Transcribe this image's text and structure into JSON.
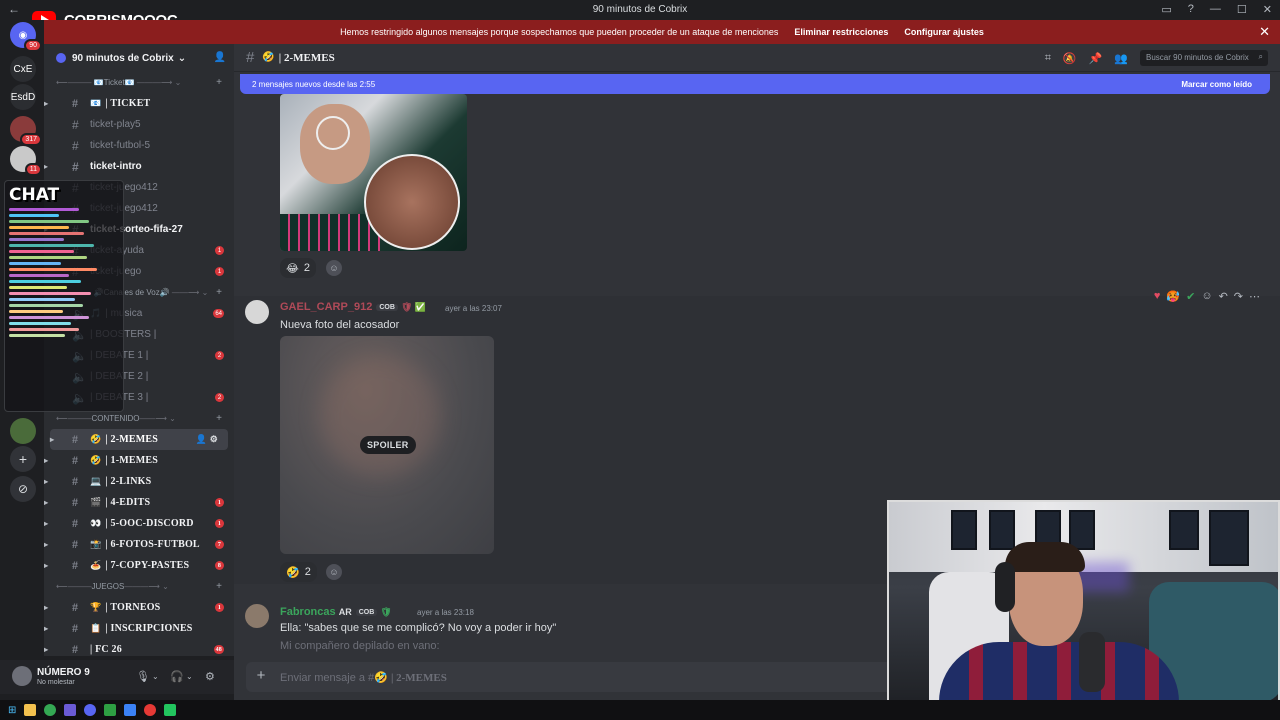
{
  "titlebar": {
    "back_icon": "arrow-left-icon",
    "youtube_channel": "COBRISMOOOC",
    "window_title": "90 minutos de Cobrix"
  },
  "banner": {
    "message": "Hemos restringido algunos mensajes porque sospechamos que pueden proceder de un ataque de menciones",
    "remove_label": "Eliminar restricciones",
    "settings_label": "Configurar ajustes"
  },
  "rail": {
    "items": [
      {
        "label": "",
        "badge": "90"
      },
      {
        "label": "CxE",
        "badge": ""
      },
      {
        "label": "EsdD",
        "badge": ""
      },
      {
        "label": "",
        "badge": "317"
      },
      {
        "label": "",
        "badge": "11"
      }
    ]
  },
  "overlay": {
    "chat_title": "CHAT"
  },
  "server": {
    "name": "90 minutos de Cobrix"
  },
  "sidebar": {
    "categories": {
      "ticket": "Ticket",
      "voice": "Canales de Voz",
      "content": "CONTENIDO",
      "games": "JUEGOS"
    },
    "ticket_channels": [
      {
        "emoji": "📧",
        "name": "| TICKET",
        "badge": "",
        "unread": true
      },
      {
        "emoji": "",
        "name": "ticket-play5",
        "badge": "",
        "unread": false
      },
      {
        "emoji": "",
        "name": "ticket-futbol-5",
        "badge": "",
        "unread": false
      },
      {
        "emoji": "",
        "name": "ticket-intro",
        "badge": "",
        "unread": true
      },
      {
        "emoji": "",
        "name": "ticket-juego412",
        "badge": "",
        "unread": false
      },
      {
        "emoji": "",
        "name": "ticket-juego412",
        "badge": "",
        "unread": false
      },
      {
        "emoji": "",
        "name": "ticket-sorteo-fifa-27",
        "badge": "",
        "unread": true
      },
      {
        "emoji": "",
        "name": "ticket-ayuda",
        "badge": "1",
        "unread": false
      },
      {
        "emoji": "",
        "name": "ticket-juego",
        "badge": "1",
        "unread": false
      }
    ],
    "voice_channels": [
      {
        "name": "| musica",
        "badge": "64"
      },
      {
        "name": "| BOOSTERS |",
        "badge": ""
      },
      {
        "name": "| DEBATE 1 |",
        "badge": "2"
      },
      {
        "name": "| DEBATE 2 |",
        "badge": ""
      },
      {
        "name": "| DEBATE 3 |",
        "badge": "2"
      }
    ],
    "content_channels": [
      {
        "emoji": "🤣",
        "name": "| 2-MEMES",
        "badge": "",
        "active": true
      },
      {
        "emoji": "🤣",
        "name": "| 1-MEMES",
        "badge": ""
      },
      {
        "emoji": "💻",
        "name": "| 2-LINKS",
        "badge": ""
      },
      {
        "emoji": "🎬",
        "name": "| 4-EDITS",
        "badge": "1"
      },
      {
        "emoji": "👀",
        "name": "| 5-OOC-DISCORD",
        "badge": "1"
      },
      {
        "emoji": "📸",
        "name": "| 6-FOTOS-FUTBOL",
        "badge": "7"
      },
      {
        "emoji": "🍝",
        "name": "| 7-COPY-PASTES",
        "badge": "8"
      }
    ],
    "game_channels": [
      {
        "emoji": "🏆",
        "name": "| TORNEOS",
        "badge": "1"
      },
      {
        "emoji": "📋",
        "name": "| INSCRIPCIONES",
        "badge": ""
      },
      {
        "emoji": "",
        "name": "| FC 26",
        "badge": "48"
      }
    ]
  },
  "user": {
    "name": "NÚMERO 9",
    "status": "No molestar"
  },
  "channel_header": {
    "emoji": "🤣",
    "name": "| 2-MEMES",
    "search_placeholder": "Buscar 90 minutos de Cobrix"
  },
  "new_messages": {
    "text": "2 mensajes nuevos desde las 2:55",
    "mark_read": "Marcar como leído"
  },
  "messages": [
    {
      "reaction": {
        "emoji": "😂",
        "count": "2"
      }
    },
    {
      "author": "GAEL_CARP_912",
      "tag": "COB",
      "timestamp": "ayer a las 23:07",
      "text": "Nueva foto del acosador",
      "spoiler_label": "SPOILER",
      "reaction": {
        "emoji": "🤣",
        "count": "2"
      },
      "toolbar_icons": [
        "heart-icon",
        "face-icon",
        "check-icon",
        "add-reaction-icon",
        "reply-icon",
        "forward-icon",
        "more-icon"
      ]
    },
    {
      "author": "Fabroncas",
      "author_suffix": "AR",
      "tag": "COB",
      "timestamp": "ayer a las 23:18",
      "text": "Ella: \"sabes que se me complicó? No voy a poder ir hoy\"",
      "text2": "Mi compañero depilado en vano:"
    }
  ],
  "composer": {
    "placeholder_prefix": "Enviar mensaje a #",
    "emoji": "🤣",
    "channel": "| 2-MEMES"
  },
  "colors": {
    "accent": "#5865f2",
    "banner": "#8b1e1e",
    "badge": "#da373c",
    "gael_name": "#b04a58",
    "fabroncas_name": "#3ba55c"
  }
}
